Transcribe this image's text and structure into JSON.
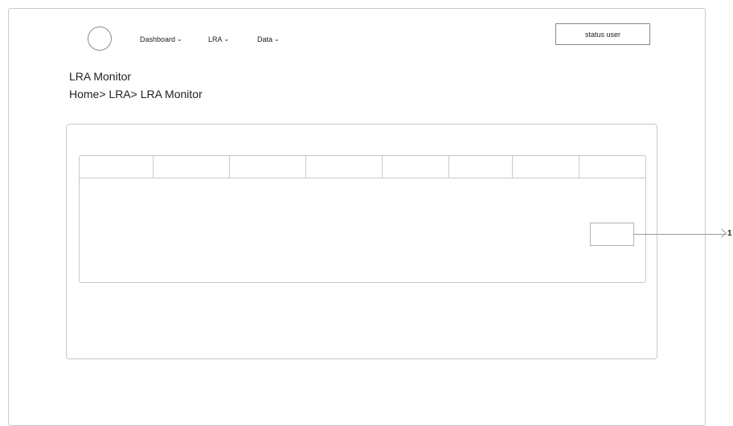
{
  "header": {
    "logo": "circle-logo",
    "nav": [
      {
        "label": "Dashboard",
        "icon": "chevron-down-icon"
      },
      {
        "label": "LRA",
        "icon": "chevron-down-icon"
      },
      {
        "label": "Data",
        "icon": "chevron-down-icon"
      }
    ],
    "status_button": "status user"
  },
  "page": {
    "title": "LRA Monitor",
    "breadcrumb": "Home> LRA> LRA Monitor"
  },
  "tabs": [
    "",
    "",
    "",
    "",
    "",
    "",
    "",
    ""
  ],
  "annotation": {
    "callout_number": "1"
  }
}
